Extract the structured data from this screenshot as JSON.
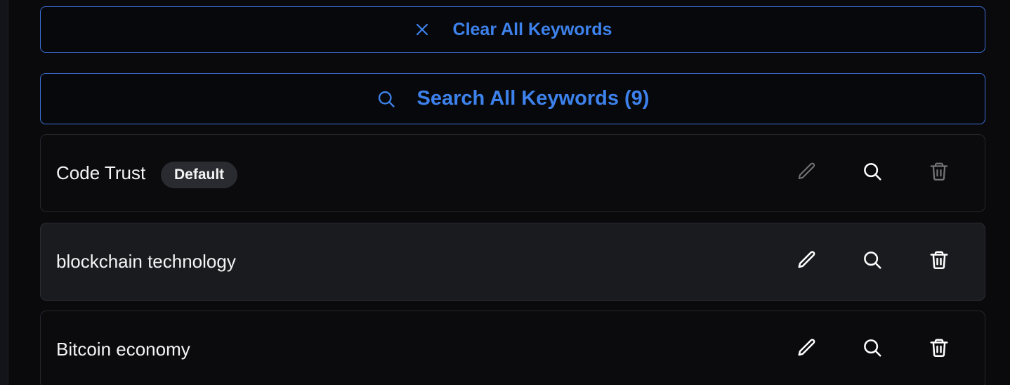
{
  "actions": {
    "clear_label": "Clear All Keywords",
    "clear_icon": "x-icon",
    "search_label": "Search All Keywords (9)",
    "search_icon": "search-icon"
  },
  "keywords": [
    {
      "text": "Code Trust",
      "badge": "Default",
      "edit_enabled": false,
      "delete_enabled": false
    },
    {
      "text": "blockchain technology",
      "badge": "",
      "edit_enabled": true,
      "delete_enabled": true
    },
    {
      "text": "Bitcoin economy",
      "badge": "",
      "edit_enabled": true,
      "delete_enabled": true
    }
  ],
  "row_icons": [
    "pencil-icon",
    "search-icon",
    "trash-icon"
  ],
  "colors": {
    "accent": "#3d82ec",
    "accent_border": "#3b6fd6",
    "background": "#0a0a0d",
    "row_highlight": "#1a1b1f",
    "badge_bg": "#2a2b30",
    "text": "#f4f4f5"
  }
}
